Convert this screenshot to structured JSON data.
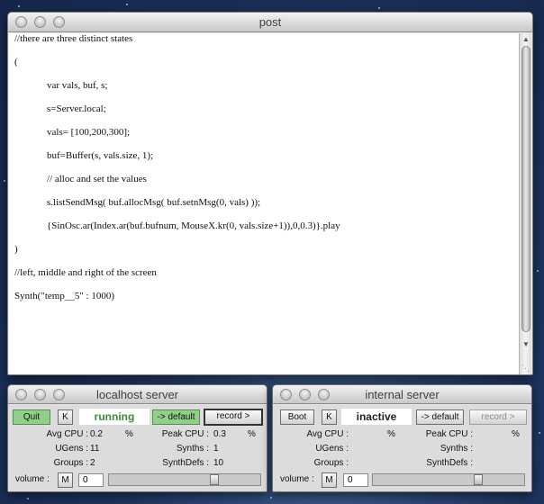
{
  "post": {
    "title": "post",
    "lines": [
      {
        "text": "//there are three distinct states",
        "indent": false
      },
      {
        "text": "(",
        "indent": false
      },
      {
        "text": "var vals, buf, s;",
        "indent": true
      },
      {
        "text": "s=Server.local;",
        "indent": true
      },
      {
        "text": "vals= [100,200,300];",
        "indent": true
      },
      {
        "text": "buf=Buffer(s, vals.size, 1);",
        "indent": true
      },
      {
        "text": "// alloc and set the values",
        "indent": true
      },
      {
        "text": "s.listSendMsg( buf.allocMsg( buf.setnMsg(0, vals) ));",
        "indent": true
      },
      {
        "text": "{SinOsc.ar(Index.ar(buf.bufnum, MouseX.kr(0, vals.size+1)),0,0.3)}.play",
        "indent": true
      },
      {
        "text": ")",
        "indent": false
      },
      {
        "text": "//left, middle and right of the screen",
        "indent": false
      },
      {
        "text": "Synth(\"temp__5\" : 1000)",
        "indent": false
      }
    ],
    "scroll_up_icon": "arrow-up-icon",
    "scroll_down_icon": "arrow-down-icon"
  },
  "localhost": {
    "title": "localhost server",
    "quit_label": "Quit",
    "k_label": "K",
    "status": "running",
    "status_color": "#3a8a3a",
    "default_label": "-> default",
    "record_label": "record >",
    "avg_cpu_label": "Avg CPU :",
    "avg_cpu": "0.2",
    "peak_cpu_label": "Peak CPU :",
    "peak_cpu": "0.3",
    "percent": "%",
    "ugens_label": "UGens :",
    "ugens": "11",
    "synths_label": "Synths :",
    "synths": "1",
    "groups_label": "Groups :",
    "groups": "2",
    "synthdefs_label": "SynthDefs :",
    "synthdefs": "10",
    "volume_label": "volume :",
    "mute_label": "M",
    "volume_value": "0"
  },
  "internal": {
    "title": "internal server",
    "boot_label": "Boot",
    "k_label": "K",
    "status": "inactive",
    "status_color": "#222222",
    "default_label": "-> default",
    "record_label": "record >",
    "avg_cpu_label": "Avg CPU :",
    "peak_cpu_label": "Peak CPU :",
    "percent": "%",
    "ugens_label": "UGens :",
    "synths_label": "Synths :",
    "groups_label": "Groups :",
    "synthdefs_label": "SynthDefs :",
    "volume_label": "volume :",
    "mute_label": "M",
    "volume_value": "0"
  }
}
